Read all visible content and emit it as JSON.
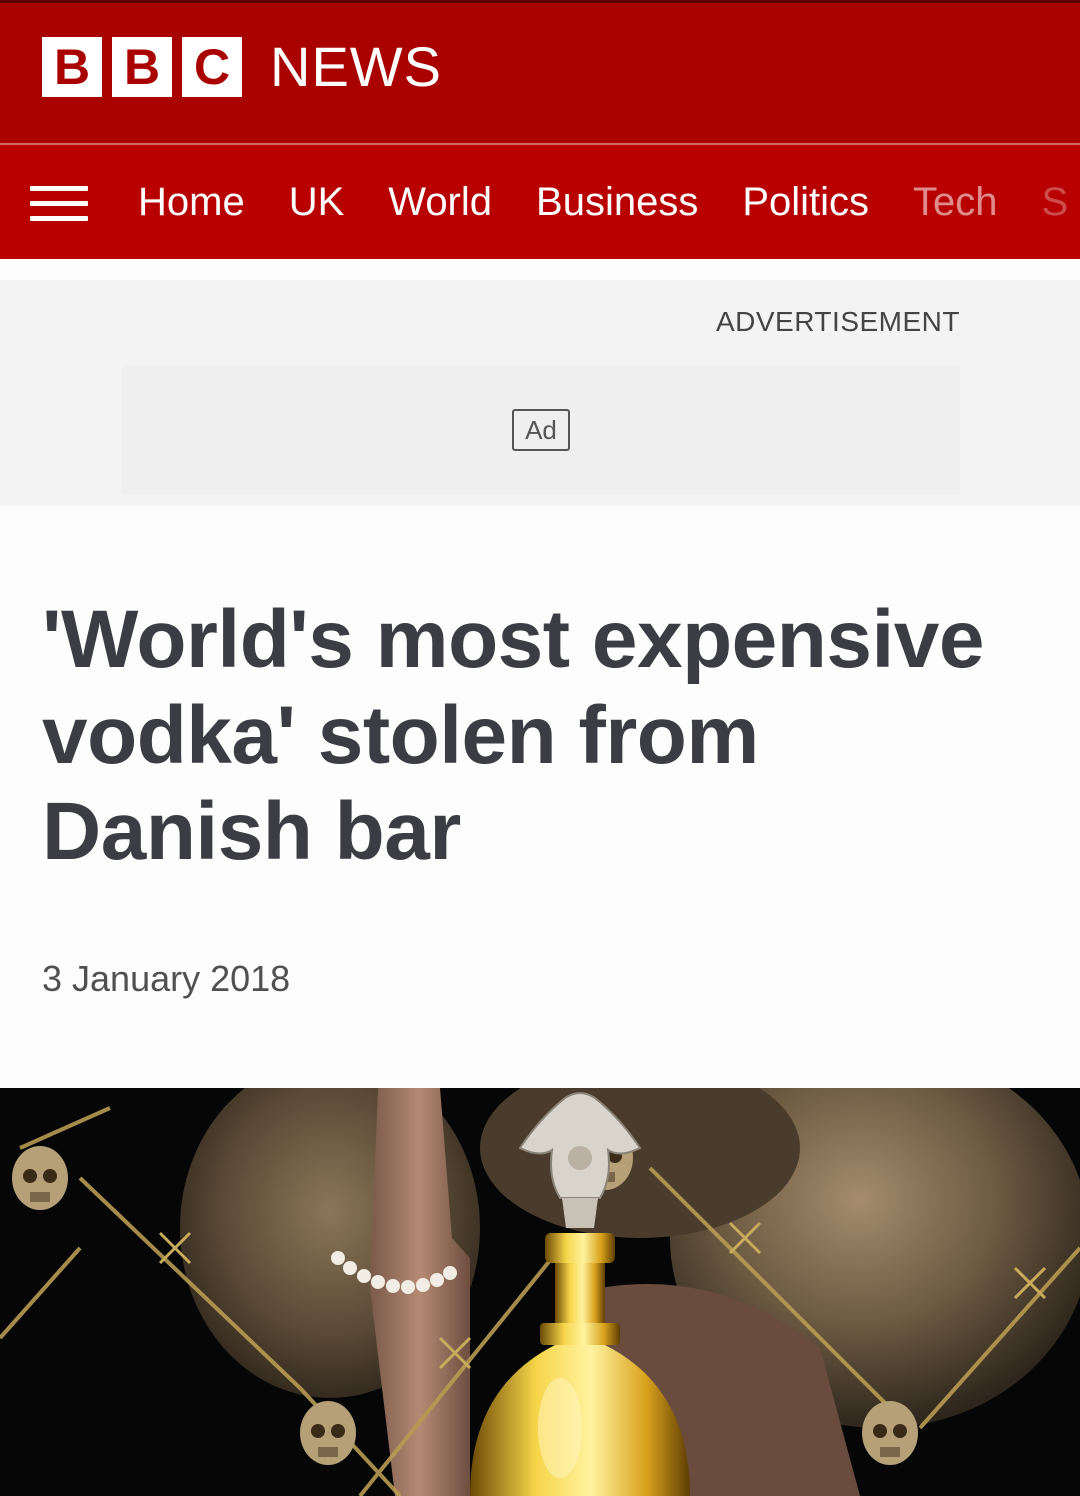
{
  "masthead": {
    "logo_letters": [
      "B",
      "B",
      "C"
    ],
    "logo_word": "NEWS"
  },
  "nav": {
    "items": [
      "Home",
      "UK",
      "World",
      "Business",
      "Politics",
      "Tech",
      "S"
    ]
  },
  "ad": {
    "label": "ADVERTISEMENT",
    "badge": "Ad"
  },
  "article": {
    "headline": "'World's most expensive vodka' stolen from Danish bar",
    "date": "3 January 2018"
  },
  "hero_image": {
    "description_icons": [
      "fur-collar",
      "golden-vodka-bottle",
      "skull-crest-icon",
      "barbed-wire-pattern",
      "pearl-bracelet",
      "eagle-crest-icon"
    ]
  },
  "colors": {
    "masthead_bg": "#a90000",
    "nav_bg": "#b80000",
    "headline": "#3c3c44"
  }
}
